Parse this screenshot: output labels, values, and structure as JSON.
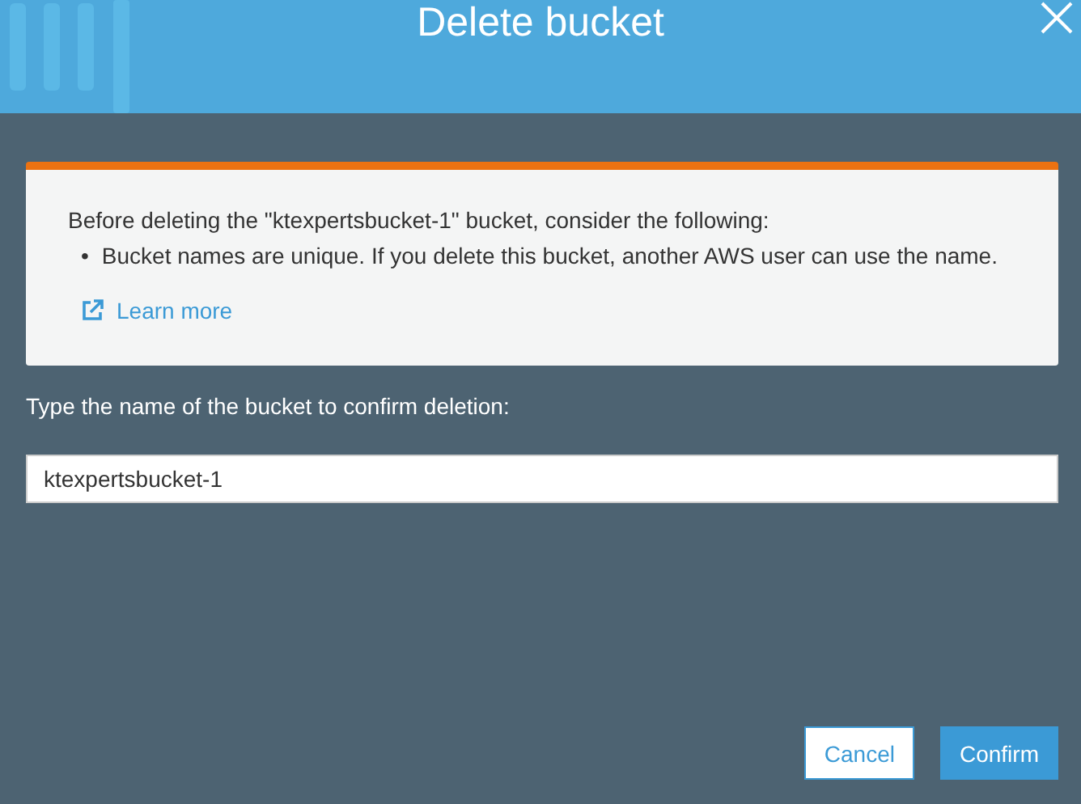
{
  "dialog": {
    "title": "Delete bucket"
  },
  "notice": {
    "intro": "Before deleting the \"ktexpertsbucket-1\" bucket, consider the following:",
    "points": [
      {
        "marker": "•",
        "text": "Bucket names are unique. If you delete this bucket, another AWS user can use the name."
      }
    ],
    "link": "Learn more"
  },
  "confirm_field": {
    "label": "Type the name of the bucket to confirm deletion:",
    "value": "ktexpertsbucket-1"
  },
  "buttons": [
    {
      "label": "Cancel",
      "kind": "secondary"
    },
    {
      "label": "Confirm",
      "kind": "primary"
    }
  ]
}
